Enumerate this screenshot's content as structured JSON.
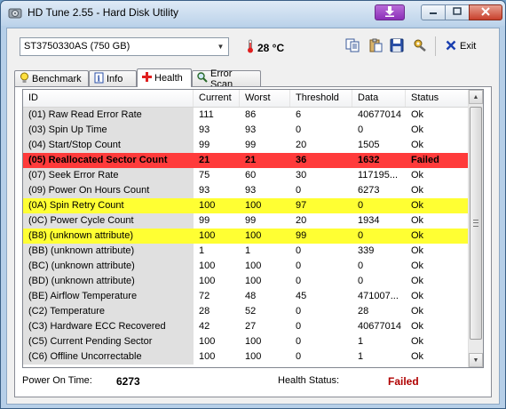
{
  "window": {
    "title": "HD Tune 2.55 - Hard Disk Utility"
  },
  "toolbar": {
    "drive": "ST3750330AS (750 GB)",
    "temperature": "28 °C",
    "exit_label": "Exit"
  },
  "tabs": [
    {
      "label": "Benchmark",
      "icon": "benchmark-bulb-icon",
      "active": false
    },
    {
      "label": "Info",
      "icon": "info-icon",
      "active": false
    },
    {
      "label": "Health",
      "icon": "health-cross-icon",
      "active": true
    },
    {
      "label": "Error Scan",
      "icon": "magnifier-icon",
      "active": false
    }
  ],
  "table": {
    "columns": [
      "ID",
      "Current",
      "Worst",
      "Threshold",
      "Data",
      "Status"
    ],
    "rows": [
      {
        "id": "(01) Raw Read Error Rate",
        "current": "111",
        "worst": "86",
        "threshold": "6",
        "data": "40677014",
        "status": "Ok",
        "highlight": "none"
      },
      {
        "id": "(03) Spin Up Time",
        "current": "93",
        "worst": "93",
        "threshold": "0",
        "data": "0",
        "status": "Ok",
        "highlight": "none"
      },
      {
        "id": "(04) Start/Stop Count",
        "current": "99",
        "worst": "99",
        "threshold": "20",
        "data": "1505",
        "status": "Ok",
        "highlight": "none"
      },
      {
        "id": "(05) Reallocated Sector Count",
        "current": "21",
        "worst": "21",
        "threshold": "36",
        "data": "1632",
        "status": "Failed",
        "highlight": "failed"
      },
      {
        "id": "(07) Seek Error Rate",
        "current": "75",
        "worst": "60",
        "threshold": "30",
        "data": "117195...",
        "status": "Ok",
        "highlight": "none"
      },
      {
        "id": "(09) Power On Hours Count",
        "current": "93",
        "worst": "93",
        "threshold": "0",
        "data": "6273",
        "status": "Ok",
        "highlight": "none"
      },
      {
        "id": "(0A) Spin Retry Count",
        "current": "100",
        "worst": "100",
        "threshold": "97",
        "data": "0",
        "status": "Ok",
        "highlight": "warn"
      },
      {
        "id": "(0C) Power Cycle Count",
        "current": "99",
        "worst": "99",
        "threshold": "20",
        "data": "1934",
        "status": "Ok",
        "highlight": "none"
      },
      {
        "id": "(B8) (unknown attribute)",
        "current": "100",
        "worst": "100",
        "threshold": "99",
        "data": "0",
        "status": "Ok",
        "highlight": "warn"
      },
      {
        "id": "(BB) (unknown attribute)",
        "current": "1",
        "worst": "1",
        "threshold": "0",
        "data": "339",
        "status": "Ok",
        "highlight": "none"
      },
      {
        "id": "(BC) (unknown attribute)",
        "current": "100",
        "worst": "100",
        "threshold": "0",
        "data": "0",
        "status": "Ok",
        "highlight": "none"
      },
      {
        "id": "(BD) (unknown attribute)",
        "current": "100",
        "worst": "100",
        "threshold": "0",
        "data": "0",
        "status": "Ok",
        "highlight": "none"
      },
      {
        "id": "(BE) Airflow Temperature",
        "current": "72",
        "worst": "48",
        "threshold": "45",
        "data": "471007...",
        "status": "Ok",
        "highlight": "none"
      },
      {
        "id": "(C2) Temperature",
        "current": "28",
        "worst": "52",
        "threshold": "0",
        "data": "28",
        "status": "Ok",
        "highlight": "none"
      },
      {
        "id": "(C3) Hardware ECC Recovered",
        "current": "42",
        "worst": "27",
        "threshold": "0",
        "data": "40677014",
        "status": "Ok",
        "highlight": "none"
      },
      {
        "id": "(C5) Current Pending Sector",
        "current": "100",
        "worst": "100",
        "threshold": "0",
        "data": "1",
        "status": "Ok",
        "highlight": "none"
      },
      {
        "id": "(C6) Offline Uncorrectable",
        "current": "100",
        "worst": "100",
        "threshold": "0",
        "data": "1",
        "status": "Ok",
        "highlight": "none"
      }
    ]
  },
  "footer": {
    "power_on_label": "Power On Time:",
    "power_on_value": "6273",
    "health_label": "Health Status:",
    "health_value": "Failed"
  },
  "colors": {
    "failed_row": "#ff3b3b",
    "warn_row": "#ffff33",
    "failed_text": "#b00000"
  }
}
